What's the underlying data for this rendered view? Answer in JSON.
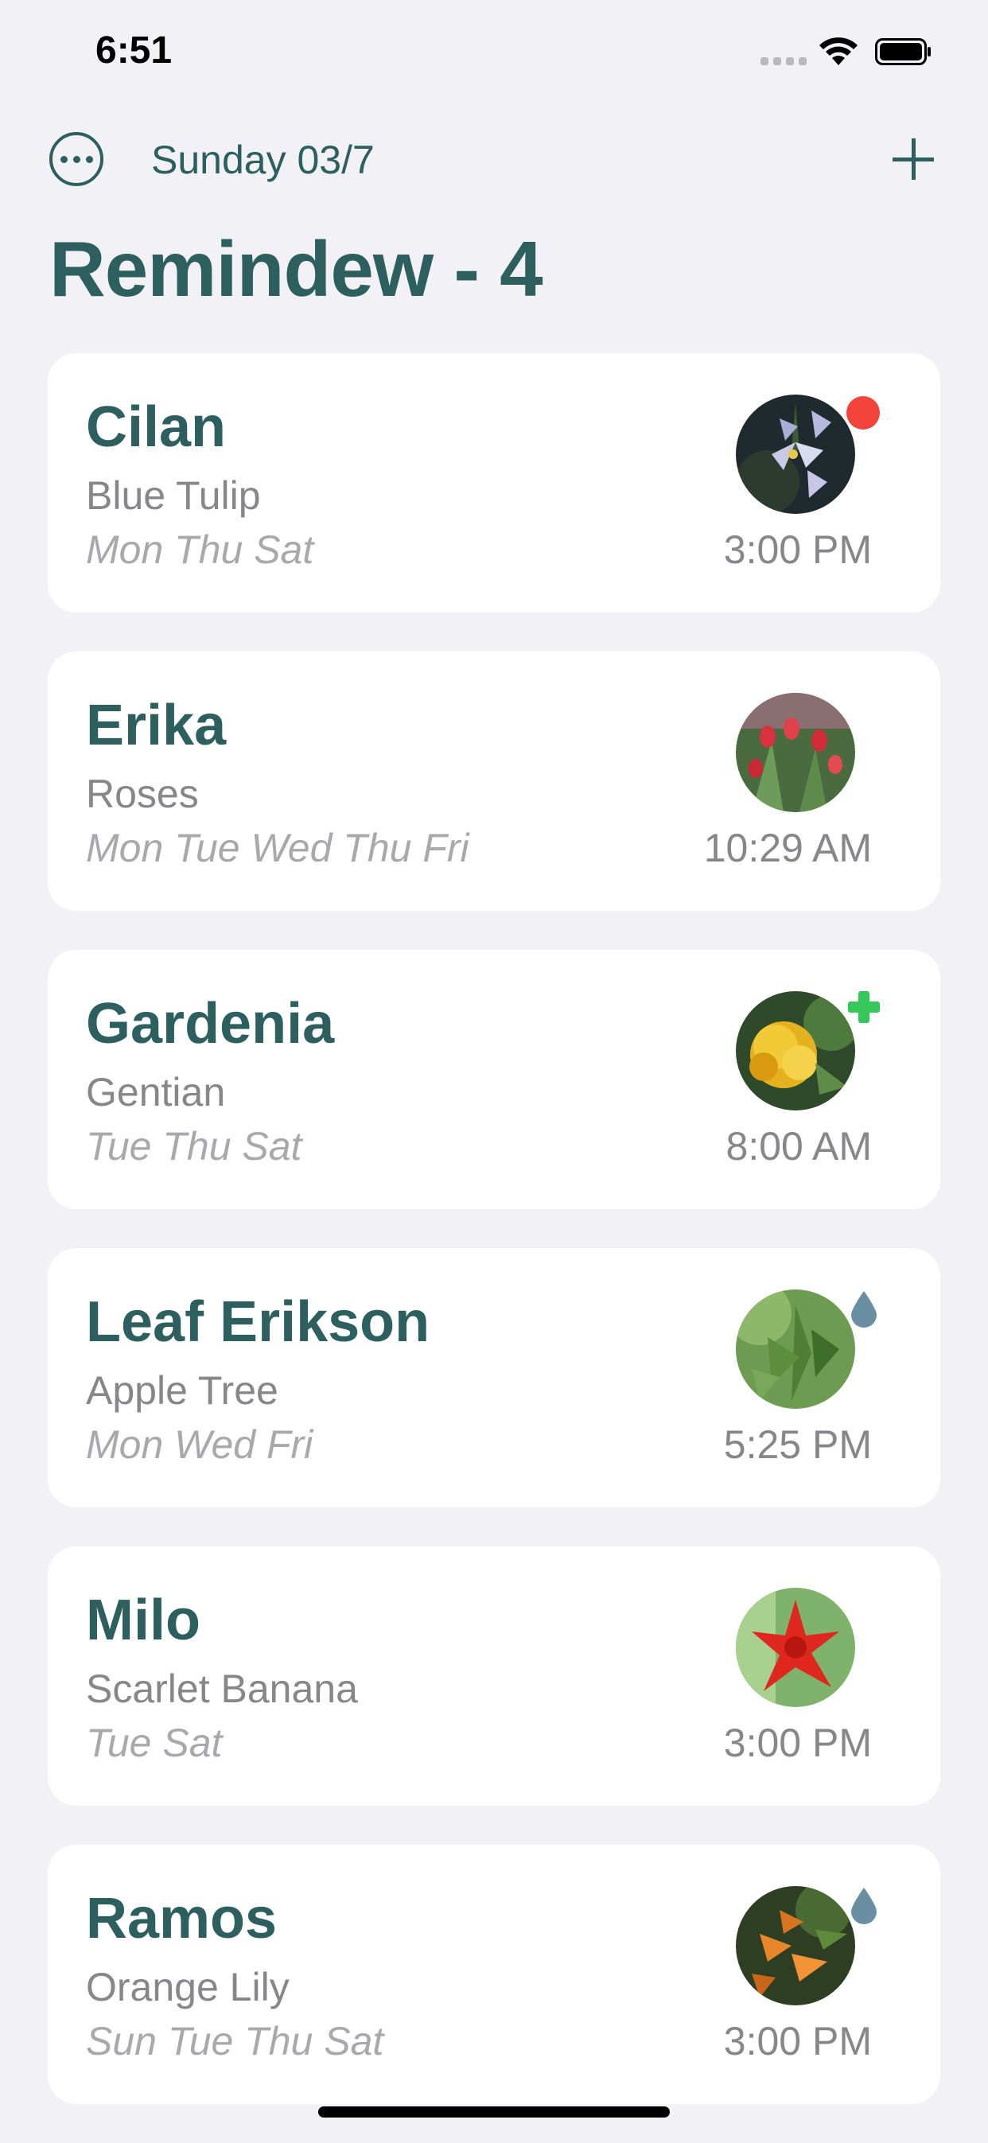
{
  "status_bar": {
    "time": "6:51"
  },
  "nav": {
    "date": "Sunday 03/7"
  },
  "title": "Remindew - 4",
  "colors": {
    "accent": "#2C5F5D",
    "alert": "#F2443B",
    "plus": "#34C759",
    "water": "#6A8FA3",
    "background": "#F2F1F6"
  },
  "reminders": [
    {
      "name": "Cilan",
      "plant": "Blue Tulip",
      "days": "Mon Thu Sat",
      "time": "3:00 PM",
      "badge": "red-dot",
      "photo": "purple-iris"
    },
    {
      "name": "Erika",
      "plant": "Roses",
      "days": "Mon Tue Wed Thu Fri",
      "time": "10:29 AM",
      "badge": "none",
      "photo": "red-tulips"
    },
    {
      "name": "Gardenia",
      "plant": "Gentian",
      "days": "Tue Thu Sat",
      "time": "8:00 AM",
      "badge": "green-plus",
      "photo": "yellow-flower"
    },
    {
      "name": "Leaf Erikson",
      "plant": "Apple Tree",
      "days": "Mon Wed Fri",
      "time": "5:25 PM",
      "badge": "water-drop",
      "photo": "green-leaves"
    },
    {
      "name": "Milo",
      "plant": "Scarlet Banana",
      "days": "Tue Sat",
      "time": "3:00 PM",
      "badge": "none",
      "photo": "red-flower"
    },
    {
      "name": "Ramos",
      "plant": "Orange Lily",
      "days": "Sun Tue Thu Sat",
      "time": "3:00 PM",
      "badge": "water-drop",
      "photo": "orange-lily"
    }
  ]
}
